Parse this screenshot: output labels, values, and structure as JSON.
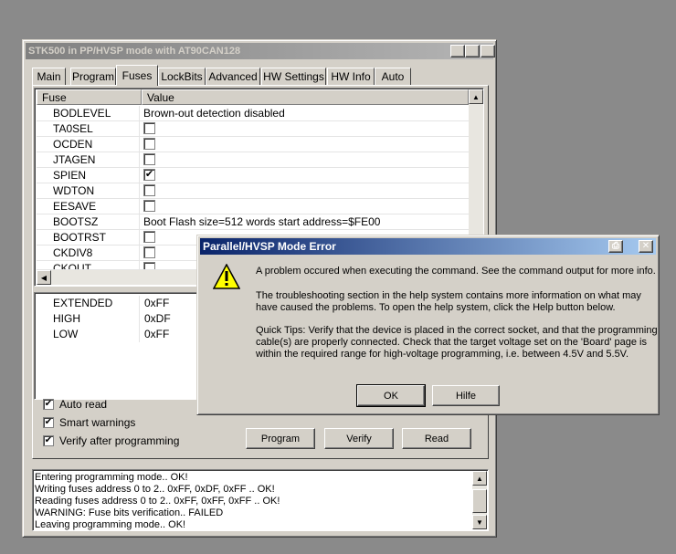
{
  "main_window": {
    "title": "STK500 in PP/HVSP mode with AT90CAN128",
    "tabs": [
      "Main",
      "Program",
      "Fuses",
      "LockBits",
      "Advanced",
      "HW Settings",
      "HW Info",
      "Auto"
    ],
    "active_tab": "Fuses"
  },
  "fuses": {
    "columns": [
      "Fuse",
      "Value"
    ],
    "rows": [
      {
        "name": "BODLEVEL",
        "value": "Brown-out detection disabled",
        "type": "text"
      },
      {
        "name": "TA0SEL",
        "type": "check",
        "checked": false
      },
      {
        "name": "OCDEN",
        "type": "check",
        "checked": false
      },
      {
        "name": "JTAGEN",
        "type": "check",
        "checked": false
      },
      {
        "name": "SPIEN",
        "type": "check",
        "checked": true
      },
      {
        "name": "WDTON",
        "type": "check",
        "checked": false
      },
      {
        "name": "EESAVE",
        "type": "check",
        "checked": false
      },
      {
        "name": "BOOTSZ",
        "value": "Boot Flash size=512 words start address=$FE00",
        "type": "text"
      },
      {
        "name": "BOOTRST",
        "type": "check",
        "checked": false
      },
      {
        "name": "CKDIV8",
        "type": "check",
        "checked": false
      },
      {
        "name": "CKOUT",
        "type": "check",
        "checked": false
      }
    ]
  },
  "registers": [
    {
      "name": "EXTENDED",
      "value": "0xFF"
    },
    {
      "name": "HIGH",
      "value": "0xDF"
    },
    {
      "name": "LOW",
      "value": "0xFF"
    }
  ],
  "options": {
    "auto_read": "Auto read",
    "smart_warnings": "Smart warnings",
    "verify_after": "Verify after programming"
  },
  "buttons": {
    "program": "Program",
    "verify": "Verify",
    "read": "Read"
  },
  "log": [
    "Entering programming mode.. OK!",
    "Writing fuses address 0 to 2.. 0xFF, 0xDF, 0xFF .. OK!",
    "Reading fuses address 0 to 2.. 0xFF, 0xFF, 0xFF .. OK!",
    "WARNING: Fuse bits verification.. FAILED",
    "Leaving programming mode.. OK!"
  ],
  "dialog": {
    "title": "Parallel/HVSP Mode Error",
    "p1": "A problem occured when executing the command. See the command output for more info.",
    "p2": "The troubleshooting section in the help system contains more information on what may have caused the problems. To open the help system, click the Help button below.",
    "p3": "Quick Tips: Verify that the device is placed in the correct socket, and that the programming cable(s) are properly connected. Check that the target voltage set on the 'Board' page is within the required range for high-voltage programming, i.e. between 4.5V and 5.5V.",
    "ok": "OK",
    "help": "Hilfe"
  },
  "icons": {
    "warning": "warning-icon",
    "close": "close-icon"
  }
}
